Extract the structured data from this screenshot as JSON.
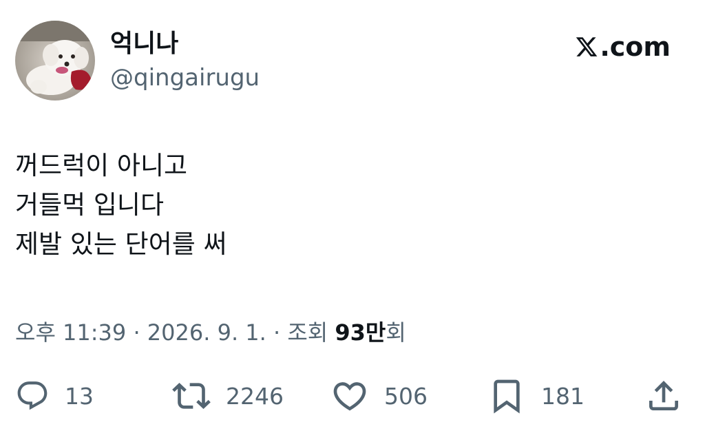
{
  "user": {
    "display_name": "억니나",
    "handle": "@qingairugu"
  },
  "brand": {
    "text": ".com"
  },
  "tweet": {
    "lines": [
      "꺼드럭이 아니고",
      "거들먹 입니다",
      "제발 있는 단어를 써"
    ]
  },
  "meta": {
    "time": "오후 11:39",
    "date": "2026. 9. 1.",
    "views_label": "조회",
    "views_count": "93만",
    "views_suffix": "회",
    "sep": " · "
  },
  "actions": {
    "replies": "13",
    "reposts": "2246",
    "likes": "506",
    "bookmarks": "181"
  },
  "colors": {
    "text": "#0f1419",
    "secondary": "#536471"
  }
}
